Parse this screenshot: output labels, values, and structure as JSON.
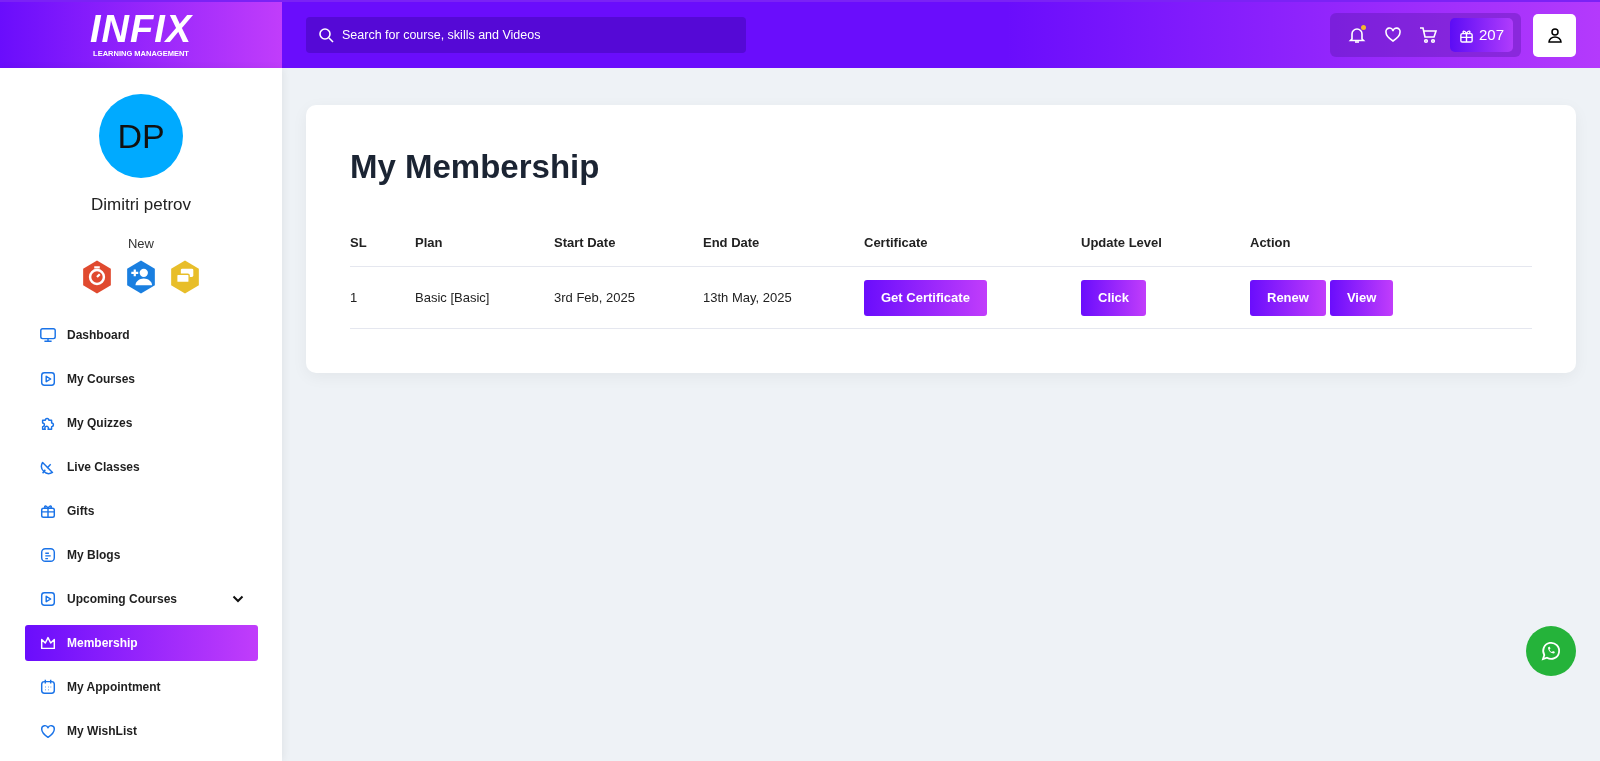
{
  "logo": {
    "title": "INFIX",
    "subtitle": "LEARNING MANAGEMENT"
  },
  "search": {
    "placeholder": "Search for course, skills and Videos"
  },
  "header": {
    "notification_dot": true,
    "points": "207"
  },
  "profile": {
    "initials": "DP",
    "name": "Dimitri petrov",
    "level": "New",
    "badges": [
      {
        "color": "#e04a2f"
      },
      {
        "color": "#1a7fe0"
      },
      {
        "color": "#e8be2a"
      }
    ]
  },
  "sidebar": {
    "items": [
      {
        "label": "Dashboard",
        "kind": "link",
        "selected": false
      },
      {
        "label": "My Courses",
        "kind": "link",
        "selected": false
      },
      {
        "label": "My Quizzes",
        "kind": "link",
        "selected": false
      },
      {
        "label": "Live Classes",
        "kind": "link",
        "selected": false
      },
      {
        "label": "Gifts",
        "kind": "link",
        "selected": false
      },
      {
        "label": "My Blogs",
        "kind": "link",
        "selected": false
      },
      {
        "label": "Upcoming Courses",
        "kind": "dropdown",
        "selected": false
      },
      {
        "label": "Membership",
        "kind": "link",
        "selected": true
      },
      {
        "label": "My Appointment",
        "kind": "link",
        "selected": false
      },
      {
        "label": "My WishList",
        "kind": "link",
        "selected": false
      }
    ]
  },
  "main": {
    "title": "My Membership",
    "table": {
      "columns": [
        "SL",
        "Plan",
        "Start Date",
        "End Date",
        "Certificate",
        "Update Level",
        "Action"
      ],
      "rows": [
        {
          "cells": [
            "1",
            "Basic [Basic]",
            "3rd Feb, 2025",
            "13th May, 2025"
          ],
          "certificate_button": "Get Certificate",
          "update_button": "Click",
          "actions": [
            "Renew",
            "View"
          ]
        }
      ]
    }
  }
}
